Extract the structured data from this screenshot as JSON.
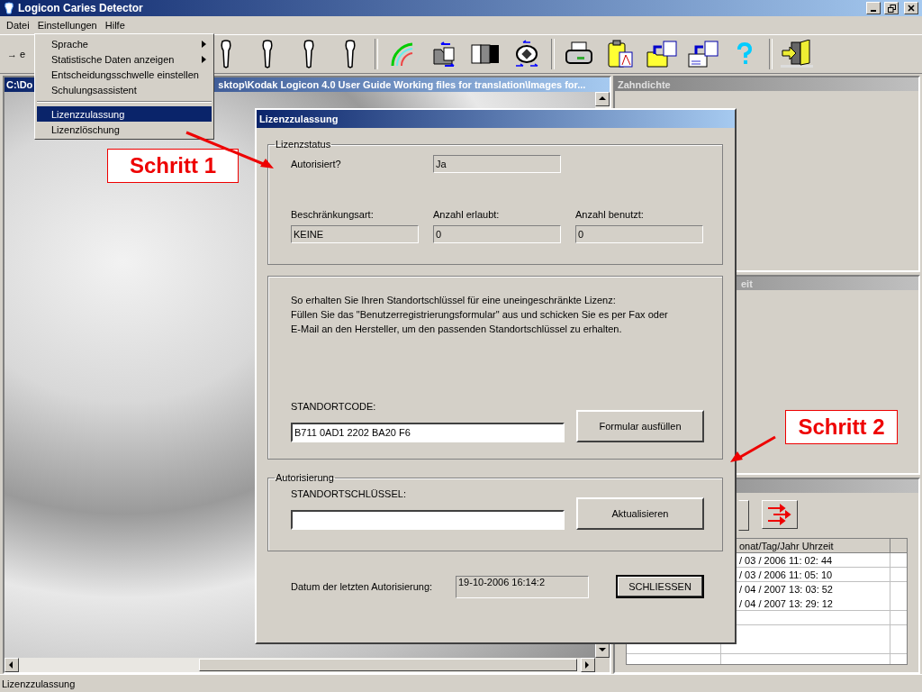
{
  "window": {
    "title": "Logicon Caries Detector"
  },
  "menu_bar": [
    {
      "label": "Datei",
      "selected": false
    },
    {
      "label": "Einstellungen",
      "selected": true
    },
    {
      "label": "Hilfe",
      "selected": false
    }
  ],
  "toolbar": {
    "first_button": "→ e"
  },
  "open_menu": [
    {
      "kind": "item",
      "label": "Sprache",
      "submenu": true,
      "selected": false
    },
    {
      "kind": "item",
      "label": "Statistische Daten anzeigen",
      "submenu": true,
      "selected": false
    },
    {
      "kind": "item",
      "label": "Entscheidungsschwelle einstellen",
      "submenu": false,
      "selected": false
    },
    {
      "kind": "item",
      "label": "Schulungsassistent",
      "submenu": false,
      "selected": false
    },
    {
      "kind": "separator"
    },
    {
      "kind": "item",
      "label": "Lizenzzulassung",
      "submenu": false,
      "selected": true
    },
    {
      "kind": "item",
      "label": "Lizenzlöschung",
      "submenu": false,
      "selected": false
    }
  ],
  "image_window": {
    "title_parts": [
      "C:\\Do",
      "sktop\\Kodak Logicon 4.0 User Guide Working files for translation\\Images for..."
    ]
  },
  "density_panel": {
    "title": "Zahndichte"
  },
  "second_panel": {
    "title": "eit"
  },
  "history_panel": {
    "columns": [
      "onat/Tag/Jahr  Uhrzeit"
    ],
    "rows": [
      [
        "/ 03 / 2006   11: 02: 44"
      ],
      [
        "/ 03 / 2006   11: 05: 10"
      ],
      [
        "/ 04 / 2007   13: 03: 52"
      ],
      [
        "/ 04 / 2007   13: 29: 12"
      ]
    ]
  },
  "dialog": {
    "title": "Lizenzzulassung",
    "status_group": {
      "legend": "Lizenzstatus",
      "authorized_label": "Autorisiert?",
      "authorized_value": "Ja",
      "fields": [
        {
          "label": "Beschränkungsart:",
          "value": "KEINE"
        },
        {
          "label": "Anzahl erlaubt:",
          "value": "0"
        },
        {
          "label": "Anzahl benutzt:",
          "value": "0"
        }
      ]
    },
    "info_group": {
      "lines": [
        "So erhalten Sie Ihren Standortschlüssel für eine uneingeschränkte Lizenz:",
        "Füllen Sie das \"Benutzerregistrierungsformular\" aus und schicken Sie es per Fax oder",
        "E-Mail an den Hersteller, um den passenden Standortschlüssel zu erhalten."
      ],
      "code_label": "STANDORTCODE:",
      "code_value": "B711 0AD1 2202 BA20 F6",
      "form_button": "Formular ausfüllen"
    },
    "auth_group": {
      "legend": "Autorisierung",
      "key_label": "STANDORTSCHLÜSSEL:",
      "update_button": "Aktualisieren"
    },
    "last_auth_label": "Datum der letzten Autorisierung:",
    "last_auth_value": "19-10-2006  16:14:2",
    "close_button": "SCHLIESSEN"
  },
  "callouts": [
    {
      "label": "Schritt 1"
    },
    {
      "label": "Schritt 2"
    }
  ],
  "status_bar": {
    "text": "Lizenzzulassung"
  }
}
